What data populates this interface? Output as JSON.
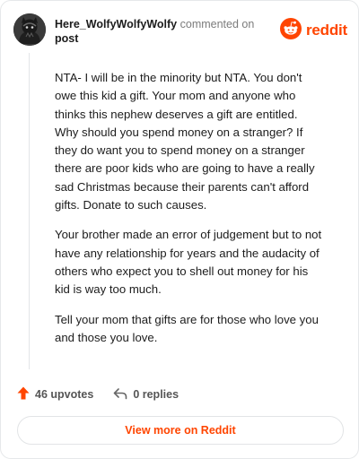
{
  "comment": {
    "username": "Here_WolfyWolfyWolfy",
    "action_text": "commented on",
    "post_link": "post",
    "paragraphs": [
      "NTA- I will be in the minority but NTA. You don't owe this kid a gift. Your mom and anyone who thinks this nephew deserves a gift are entitled. Why should you spend money on a stranger? If they do want you to spend money on a stranger there are poor kids who are going to have a really sad Christmas because their parents can't afford gifts. Donate to such causes.",
      "Your brother made an error of judgement but to not have any relationship for years and the audacity of others who expect you to shell out money for his kid is way too much.",
      "Tell your mom that gifts are for those who love you and those you love."
    ]
  },
  "brand": {
    "wordmark": "reddit",
    "color": "#ff4500"
  },
  "stats": {
    "upvotes": "46 upvotes",
    "replies": "0 replies"
  },
  "actions": {
    "view_more": "View more on Reddit"
  },
  "icons": {
    "avatar": "avatar-icon",
    "logo": "reddit-logo-icon",
    "upvote": "upvote-arrow-icon",
    "reply": "reply-arrow-icon"
  }
}
